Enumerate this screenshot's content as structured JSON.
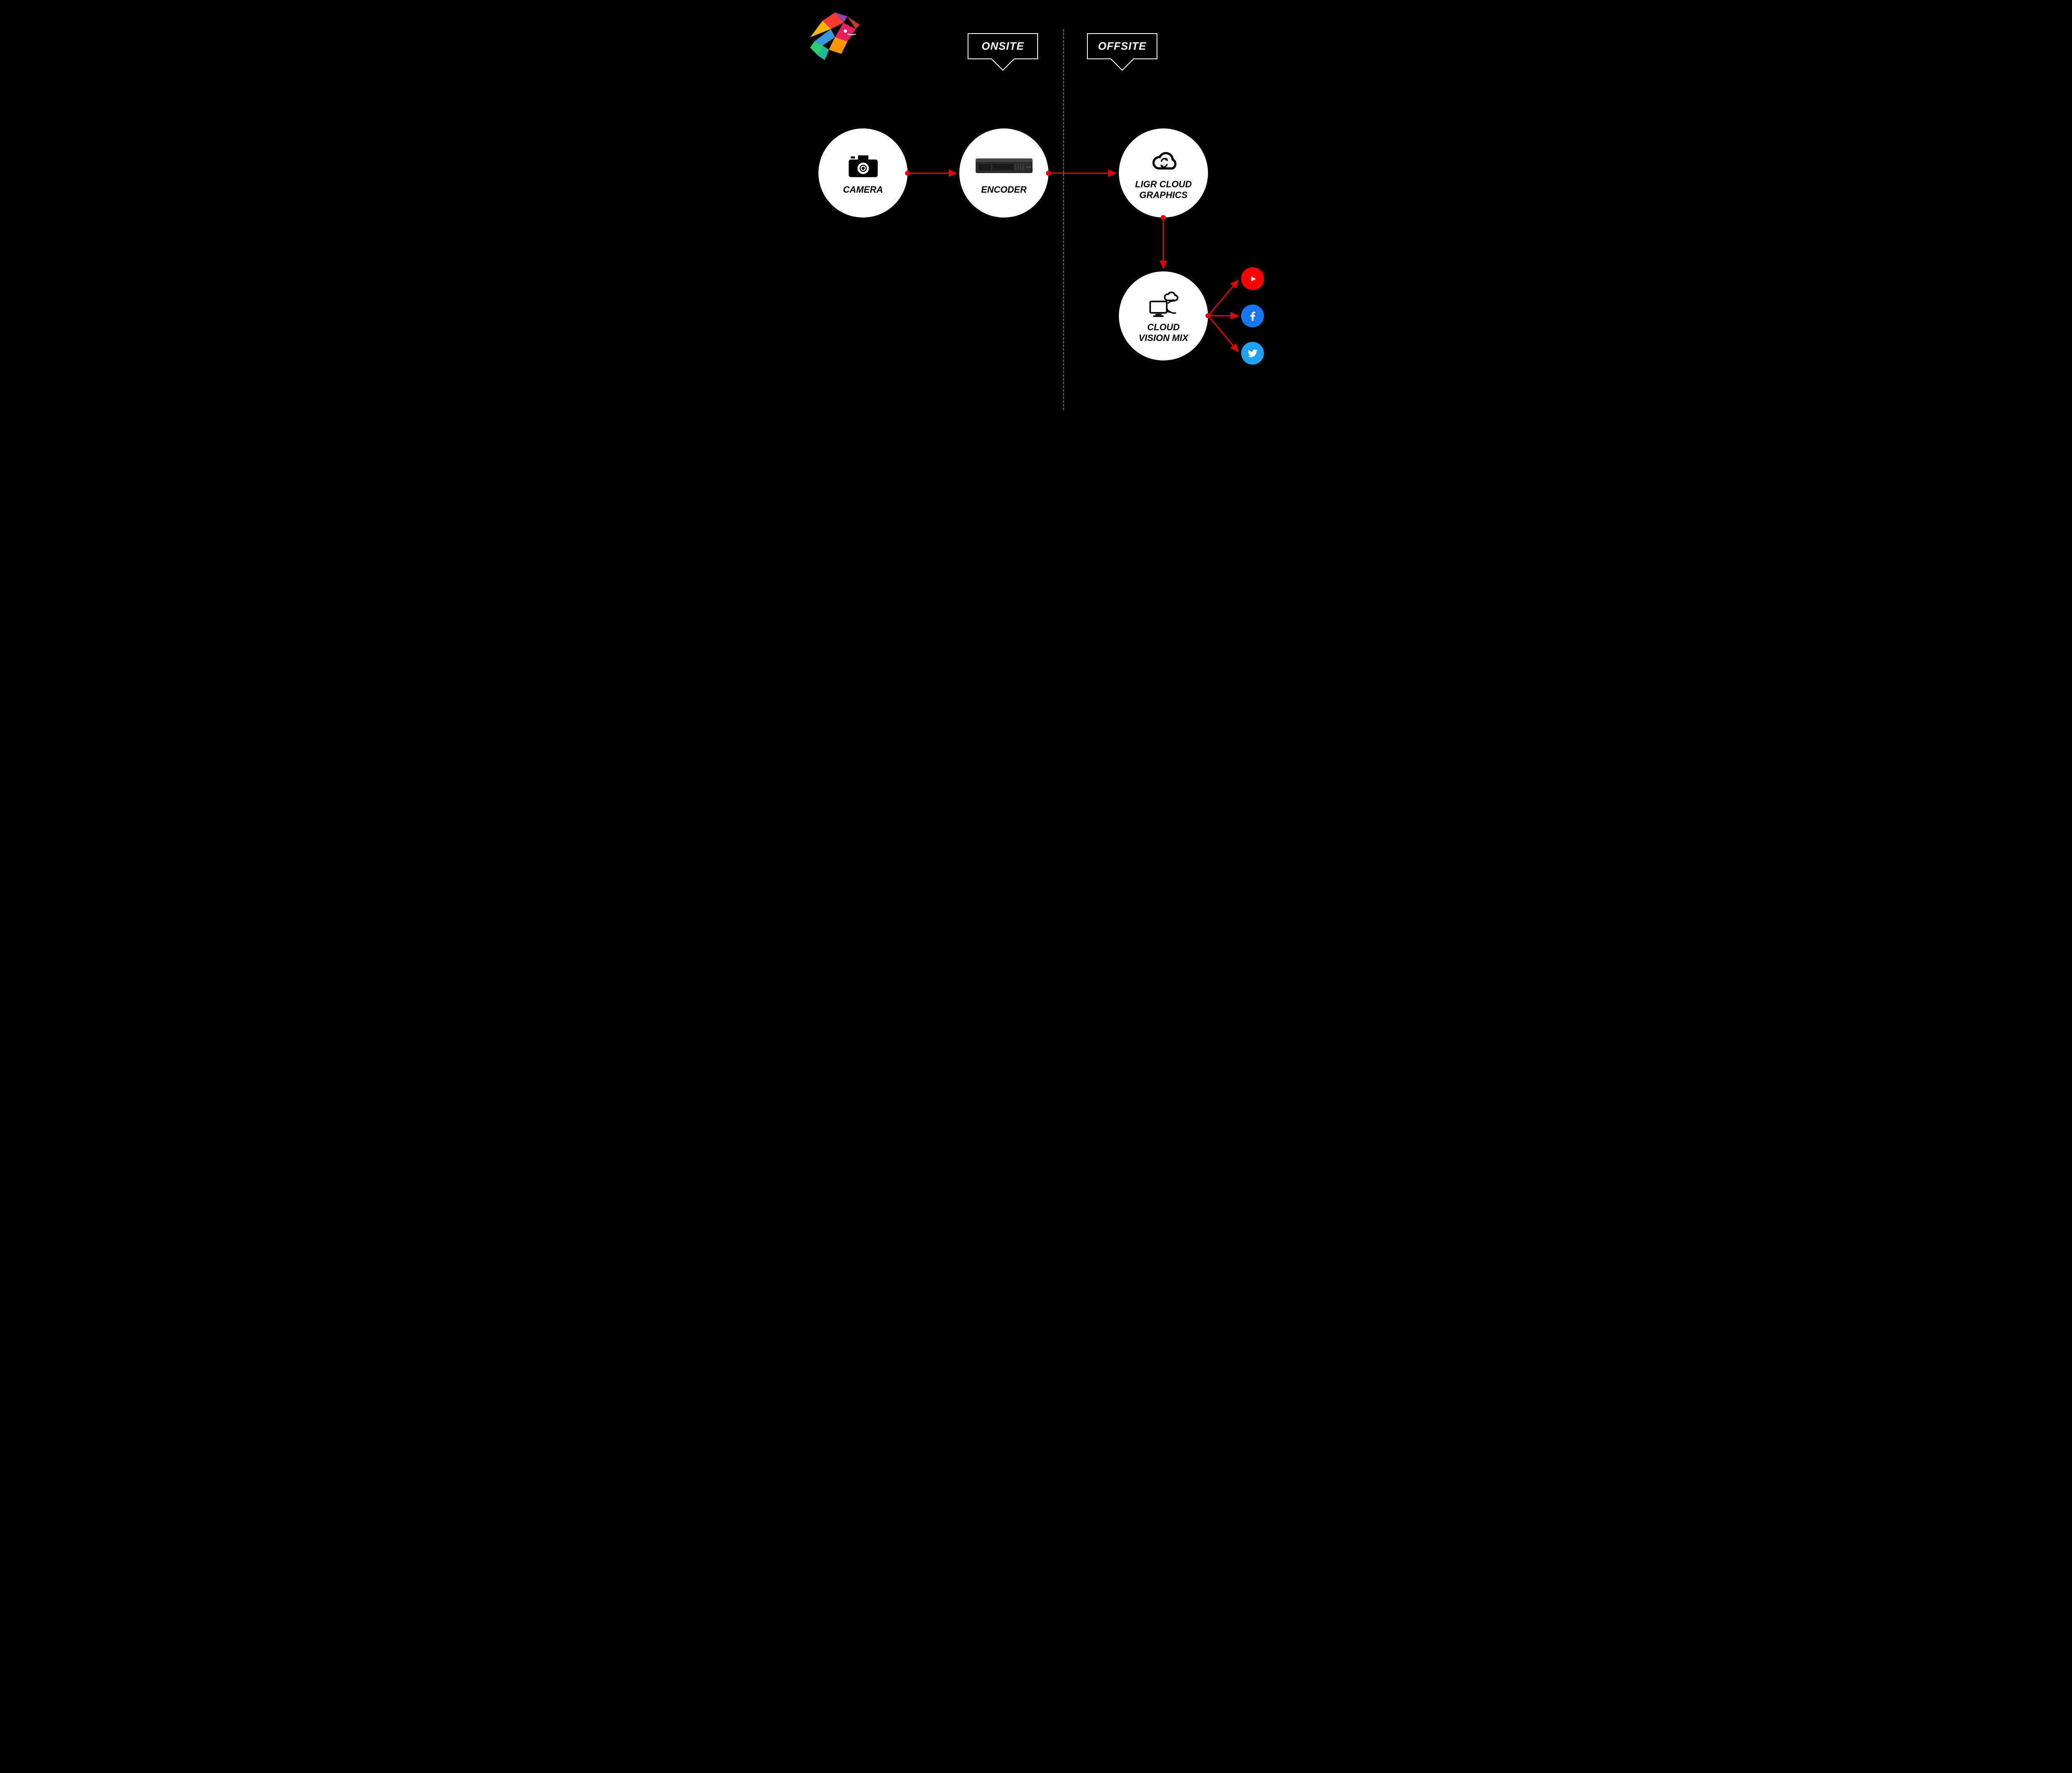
{
  "sections": {
    "onsite": "ONSITE",
    "offsite": "OFFSITE"
  },
  "nodes": {
    "camera": "CAMERA",
    "encoder": "ENCODER",
    "ligr": "LIGR CLOUD\nGRAPHICS",
    "cloudmix": "CLOUD\nVISION MIX"
  },
  "social": {
    "youtube": "YouTube",
    "facebook": "Facebook",
    "twitter": "Twitter"
  },
  "colors": {
    "arrow": "#E60000",
    "divider": "#555555",
    "bg": "#000000",
    "node": "#FFFFFF"
  }
}
